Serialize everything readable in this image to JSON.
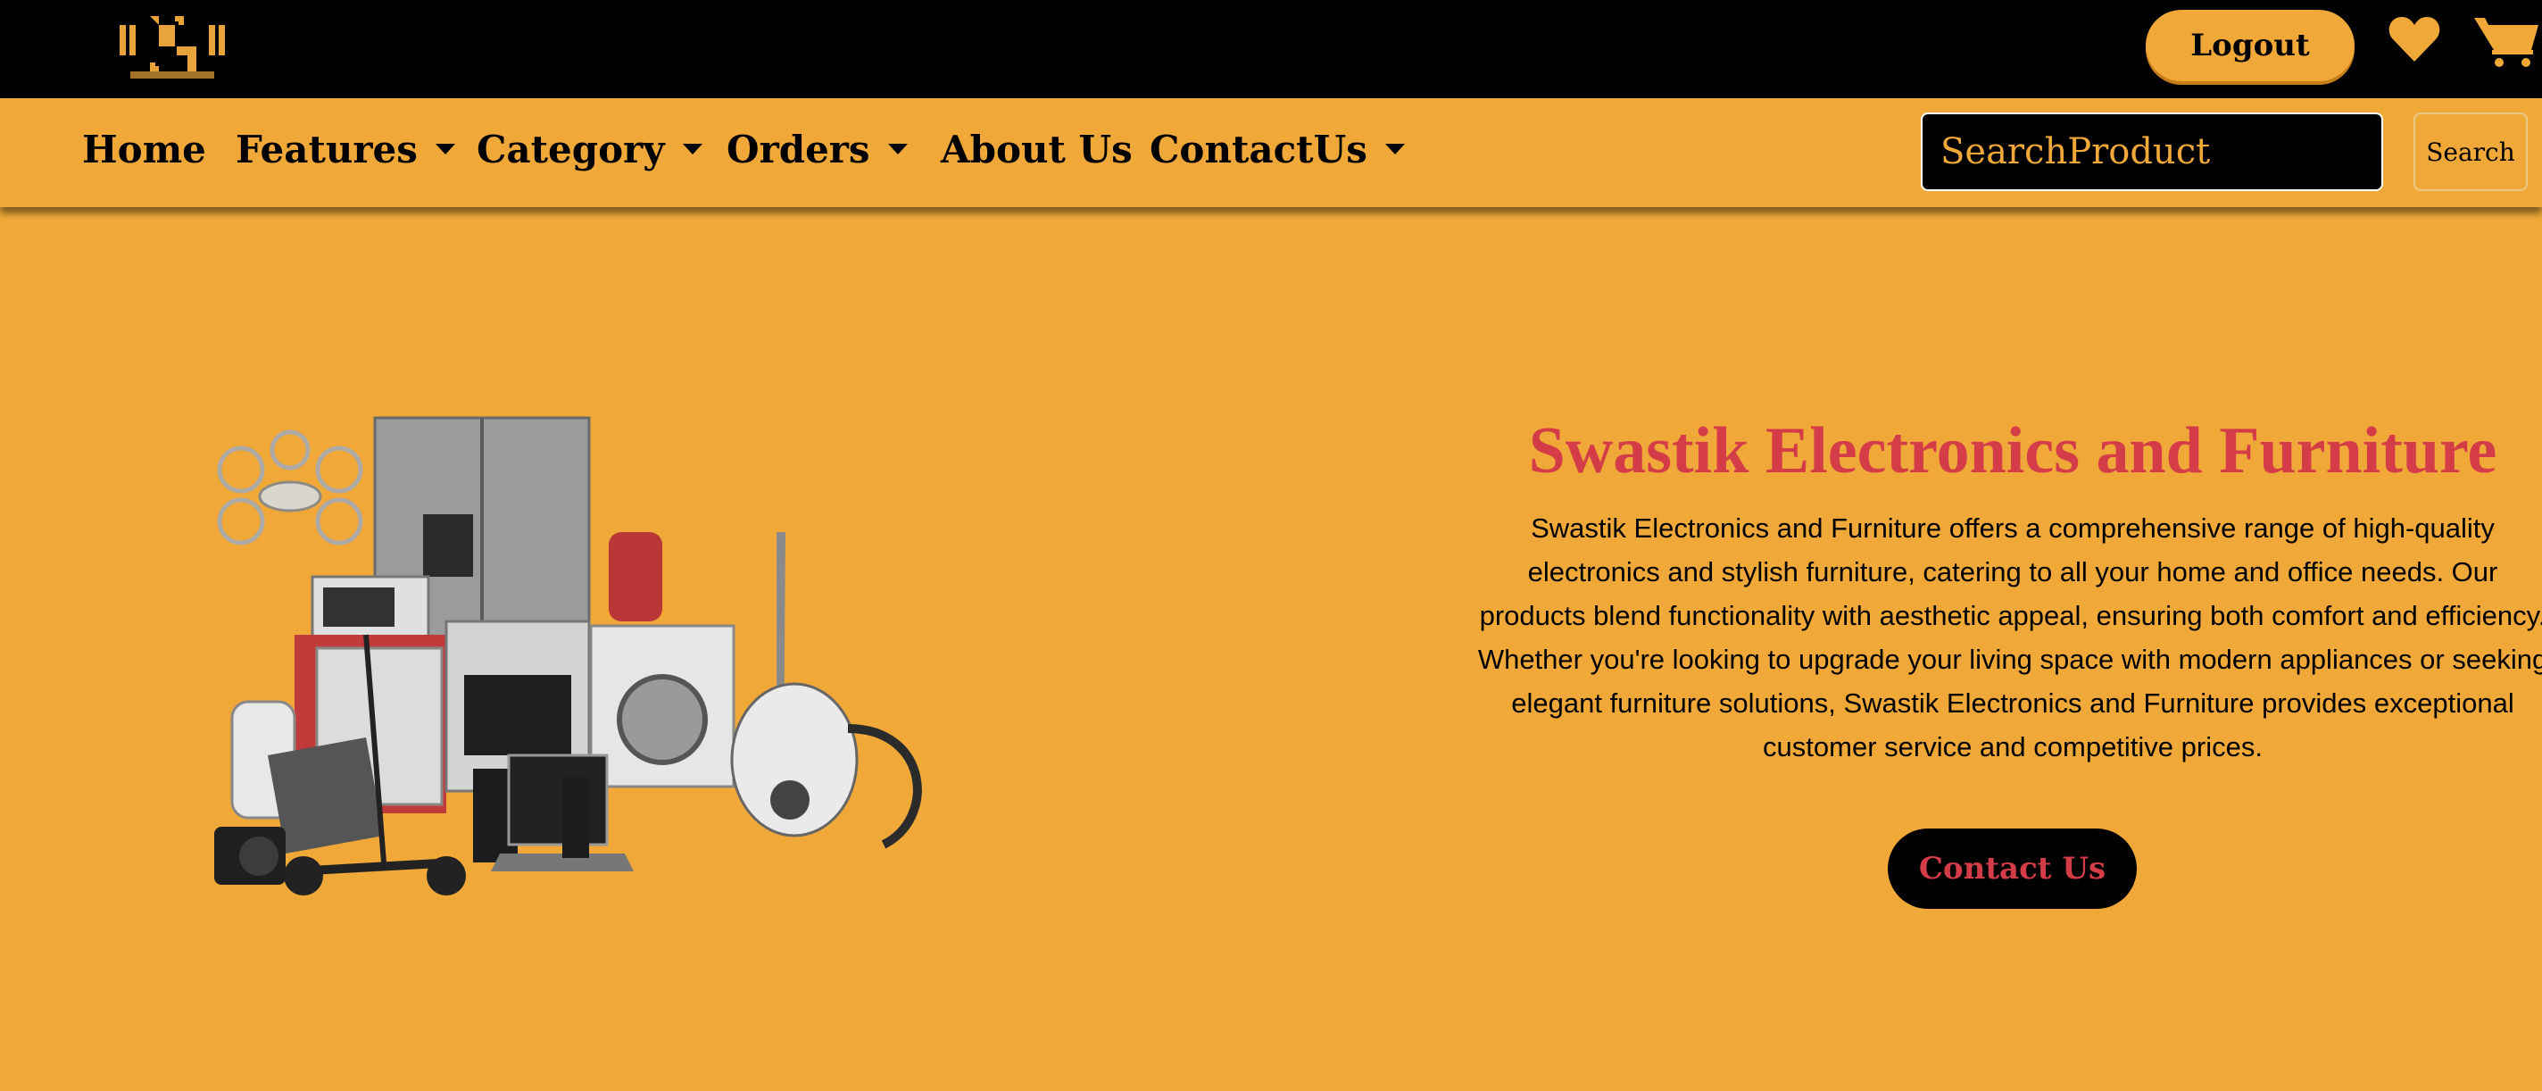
{
  "header": {
    "logo_alt": "Swastik logo",
    "logout_label": "Logout",
    "icons": [
      "heart-icon",
      "cart-icon"
    ]
  },
  "nav": {
    "items": [
      {
        "label": "Home",
        "dropdown": false
      },
      {
        "label": "Features",
        "dropdown": true
      },
      {
        "label": "Category",
        "dropdown": true
      },
      {
        "label": "Orders",
        "dropdown": true
      },
      {
        "label": "About Us",
        "dropdown": false
      },
      {
        "label": "ContactUs",
        "dropdown": true
      }
    ],
    "search_placeholder": "SearchProduct",
    "search_label": "Search"
  },
  "hero": {
    "title": "Swastik Electronics and Furniture",
    "description": "Swastik Electronics and Furniture offers a comprehensive range of high-quality\nelectronics and stylish furniture, catering to all your home and office needs. Our\nproducts blend functionality with aesthetic appeal, ensuring both comfort and efficiency.\nWhether you're looking to upgrade your living space with modern appliances or seeking\nelegant furniture solutions, Swastik Electronics and Furniture provides exceptional\ncustomer service and competitive prices.",
    "cta_label": "Contact Us"
  },
  "colors": {
    "brand_orange": "#f0a839",
    "title_red": "#d43d48",
    "black": "#000000"
  }
}
